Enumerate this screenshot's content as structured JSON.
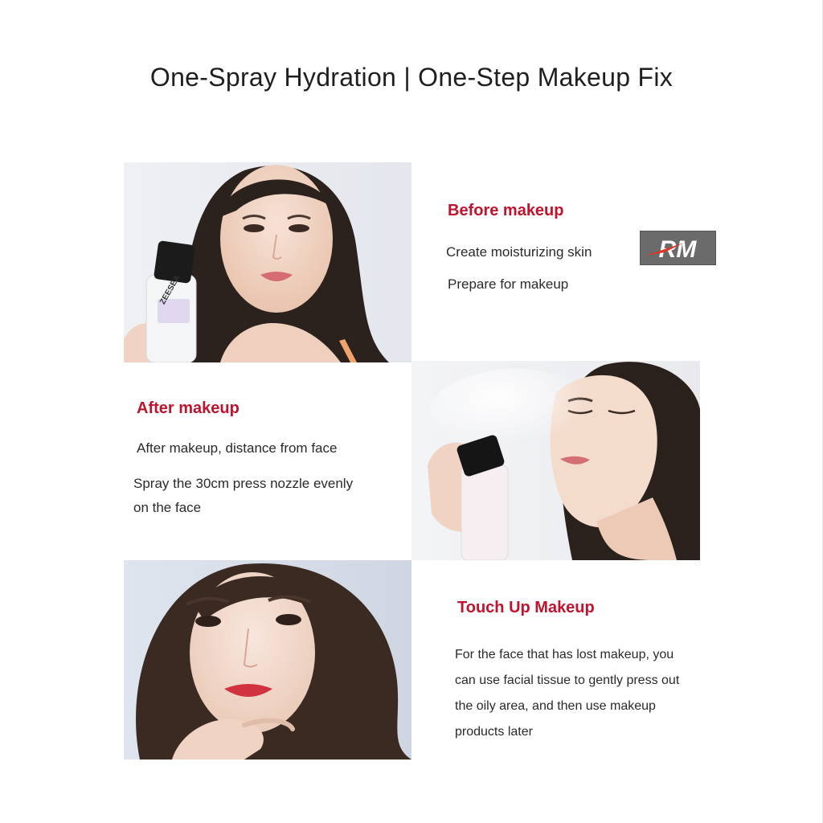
{
  "page": {
    "title": "One-Spray Hydration | One-Step Makeup Fix",
    "accent_color": "#c0132d"
  },
  "sections": {
    "before": {
      "heading": "Before makeup",
      "lines": [
        "Create moisturizing skin",
        "Prepare for makeup"
      ],
      "photo_alt": "Model holding ZEESEA setting spray bottle",
      "bottle_label": "ZEESEA"
    },
    "after": {
      "heading": "After makeup",
      "lines": [
        "After makeup, distance from face",
        "Spray the 30cm press nozzle evenly",
        "on the face"
      ],
      "photo_alt": "Model spraying mist on face"
    },
    "touchup": {
      "heading": "Touch Up Makeup",
      "lines": [
        "For the face that has lost makeup, you",
        "can use facial tissue to gently press out",
        "the oily area, and then use makeup",
        "products later"
      ],
      "photo_alt": "Model with red lips"
    }
  },
  "logo": {
    "text": "RM",
    "icon": "rm-logo-icon"
  }
}
